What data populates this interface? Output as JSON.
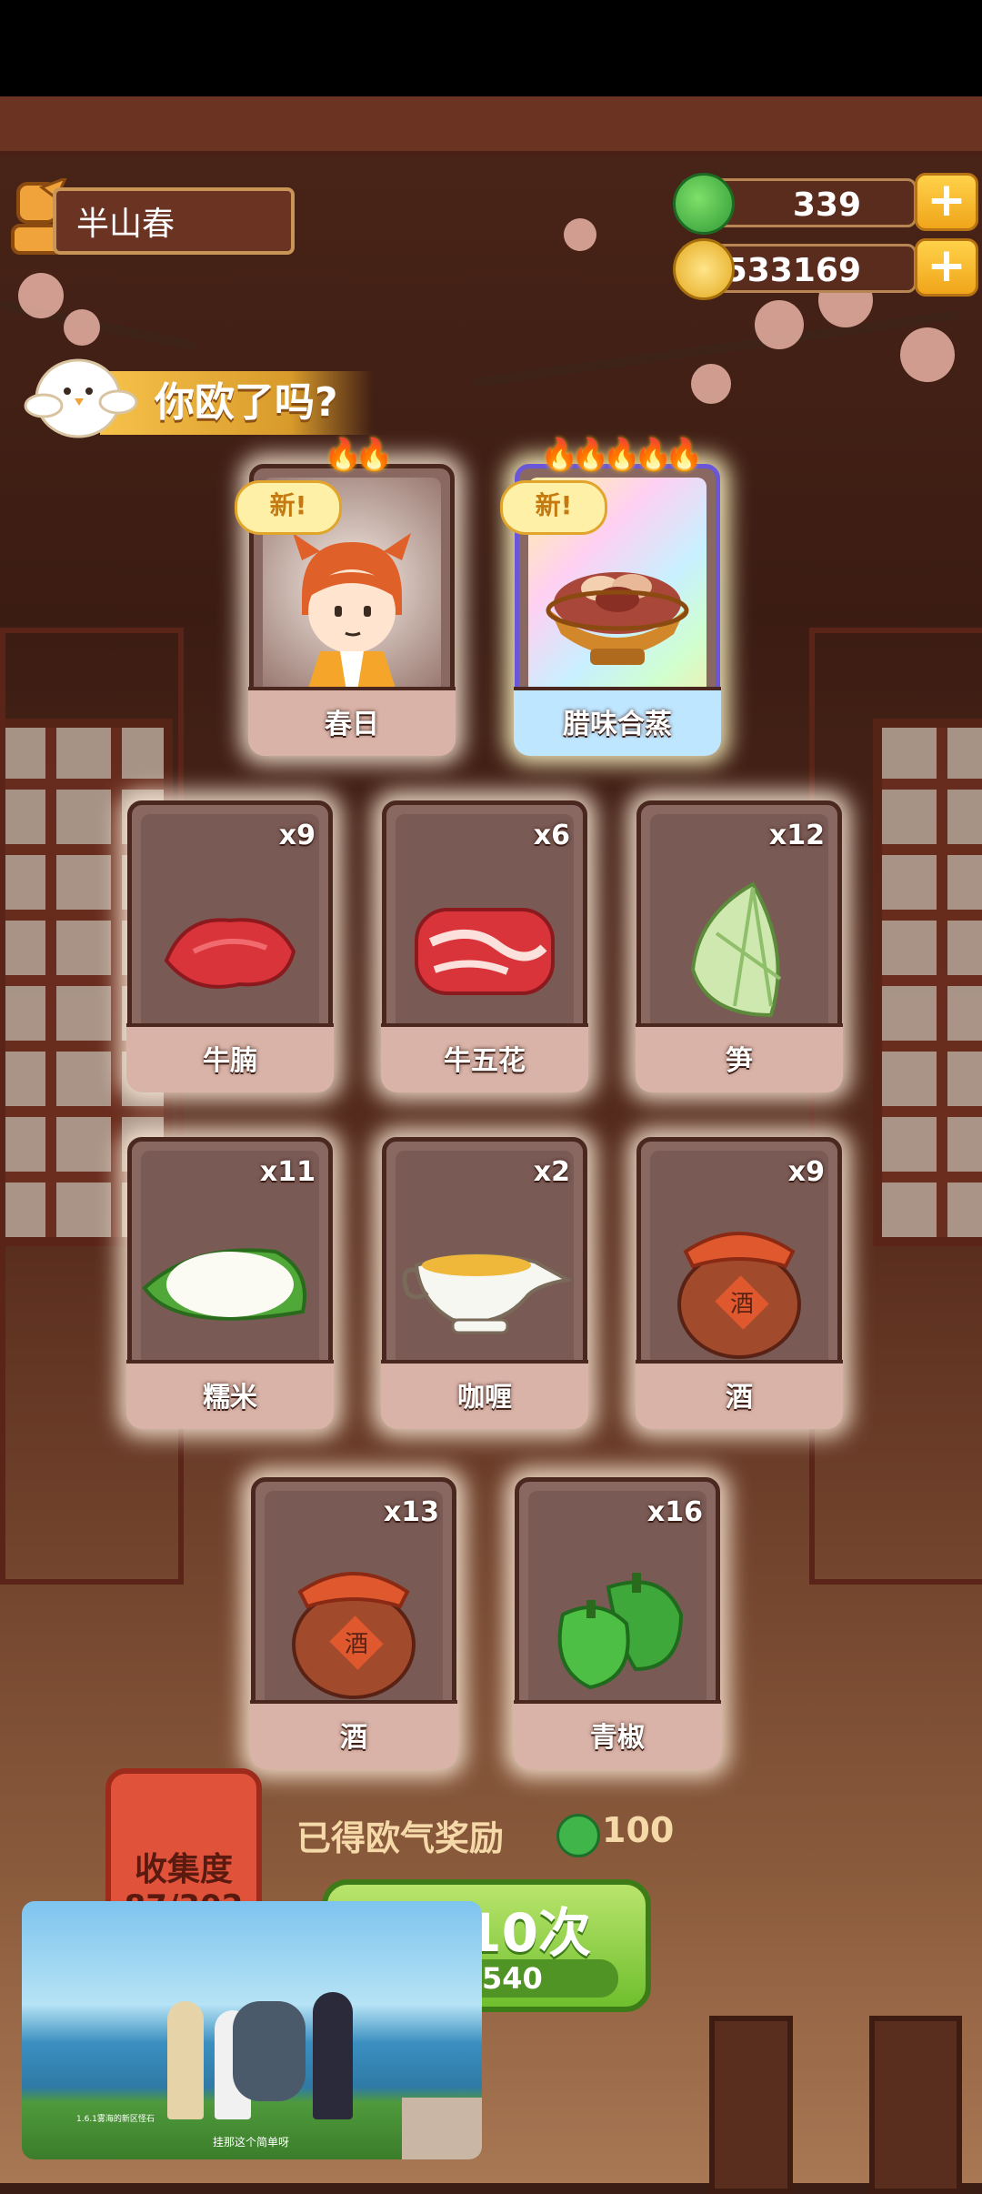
{
  "player": {
    "name": "半山春"
  },
  "currency": {
    "jade": "339",
    "coins": "533169"
  },
  "banner": {
    "text": "你欧了吗?"
  },
  "featured": [
    {
      "new_tag": "新!",
      "flames": "🔥🔥",
      "label": "春日"
    },
    {
      "new_tag": "新!",
      "flames": "🔥🔥🔥🔥🔥",
      "label": "腊味合蒸"
    }
  ],
  "ingredients": [
    {
      "label": "牛腩",
      "count": "x9"
    },
    {
      "label": "牛五花",
      "count": "x6"
    },
    {
      "label": "笋",
      "count": "x12"
    },
    {
      "label": "糯米",
      "count": "x11"
    },
    {
      "label": "咖喱",
      "count": "x2"
    },
    {
      "label": "酒",
      "count": "x9"
    },
    {
      "label": "酒",
      "count": "x13"
    },
    {
      "label": "青椒",
      "count": "x16"
    }
  ],
  "reward": {
    "text": "已得欧气奖励",
    "value": "100"
  },
  "collection": {
    "label": "收集度",
    "value": "87/302"
  },
  "draw": {
    "label": "10次",
    "cost": "540"
  },
  "video": {
    "subtitle": "1.6.1雾海的新区怪石",
    "caption": "挂那这个简单呀"
  },
  "colors": {
    "accent_green": "#6fbf2e",
    "gold": "#f6c24a",
    "card_bg": "#8a6862"
  }
}
